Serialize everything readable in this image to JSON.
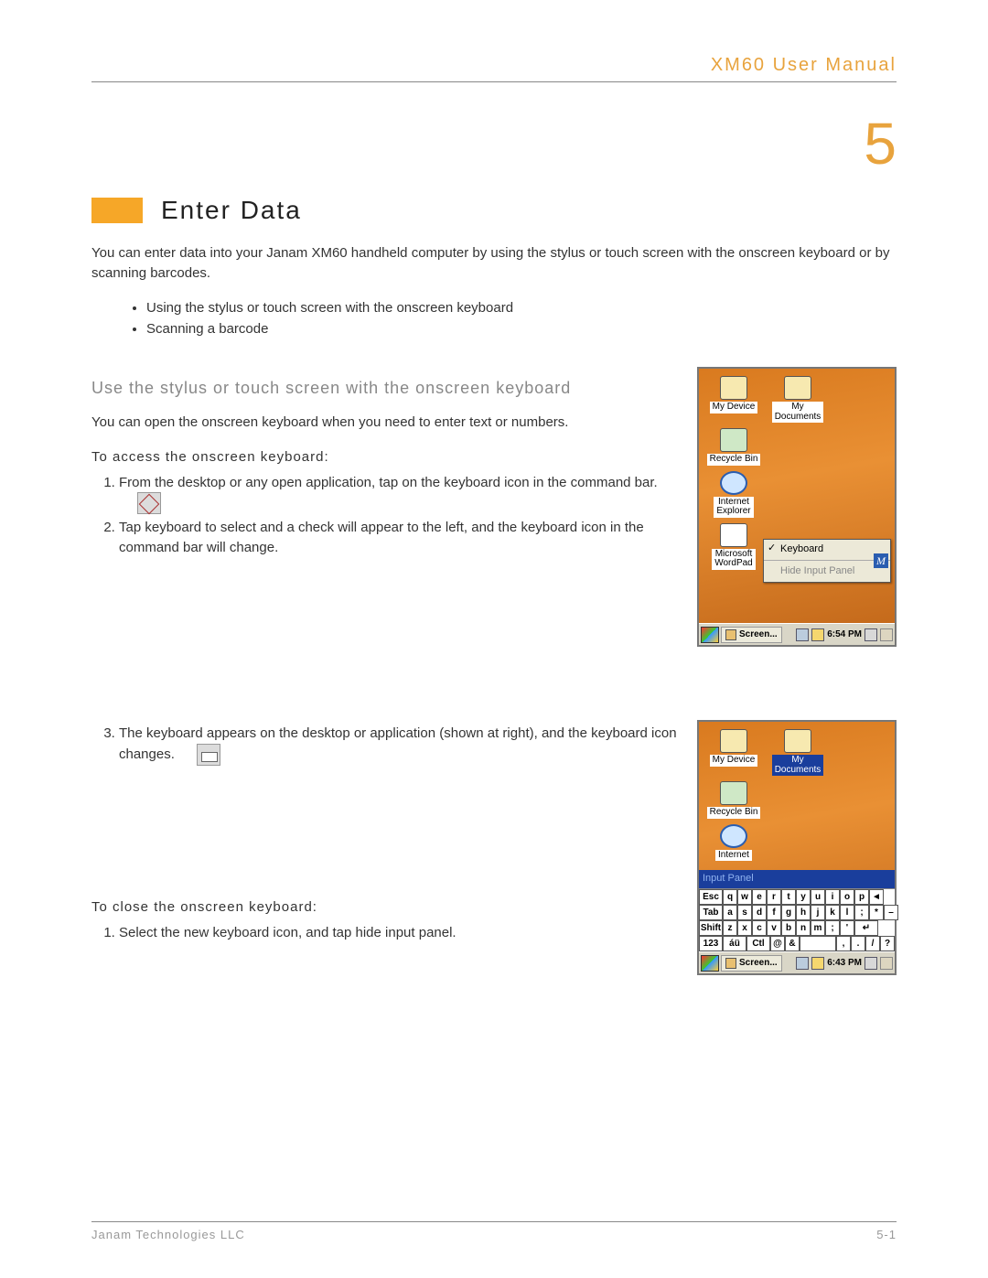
{
  "header": {
    "manual_title": "XM60 User Manual"
  },
  "chapter": "5",
  "section_title": "Enter Data",
  "intro": "You can enter data into your Janam XM60 handheld computer by using the stylus or touch screen with the onscreen keyboard or by scanning barcodes.",
  "bullets": [
    "Using the stylus or touch screen with the onscreen keyboard",
    "Scanning a barcode"
  ],
  "sub_heading": "Use the stylus or touch screen with the onscreen keyboard",
  "sub_para": "You can open the onscreen keyboard when you need to enter text or numbers.",
  "access_hd": "To access the onscreen keyboard:",
  "access_steps": [
    "From the desktop or any open application, tap on the keyboard icon in the command bar.",
    "Tap keyboard to select and a check will appear to the left, and the keyboard icon in the command bar will change."
  ],
  "step3": "The keyboard appears on the desktop or application (shown at right), and the keyboard icon changes.",
  "close_hd": "To close the onscreen keyboard:",
  "close_steps": [
    "Select the new keyboard icon, and tap hide input panel."
  ],
  "shot1": {
    "icons": {
      "my_device": "My Device",
      "my_documents": "My\nDocuments",
      "recycle_bin": "Recycle Bin",
      "internet_explorer": "Internet\nExplorer",
      "wordpad": "Microsoft\nWordPad"
    },
    "menu": {
      "keyboard": "Keyboard",
      "hide": "Hide Input Panel",
      "tag": "M"
    },
    "taskbar": {
      "app": "Screen...",
      "time": "6:54 PM"
    }
  },
  "shot2": {
    "icons": {
      "my_device": "My Device",
      "my_documents": "My\nDocuments",
      "recycle_bin": "Recycle Bin",
      "internet": "Internet"
    },
    "panel_hd": "Input Panel",
    "kb": {
      "r1": [
        "Esc",
        "q",
        "w",
        "e",
        "r",
        "t",
        "y",
        "u",
        "i",
        "o",
        "p",
        "◄"
      ],
      "r2": [
        "Tab",
        "a",
        "s",
        "d",
        "f",
        "g",
        "h",
        "j",
        "k",
        "l",
        ";",
        "*",
        "–"
      ],
      "r3": [
        "Shift",
        "z",
        "x",
        "c",
        "v",
        "b",
        "n",
        "m",
        ";",
        "'",
        "↵"
      ],
      "r4": [
        "123",
        "áü",
        "Ctl",
        "@",
        "&",
        "",
        ",",
        ".",
        "/",
        "?"
      ]
    },
    "taskbar": {
      "app": "Screen...",
      "time": "6:43 PM"
    }
  },
  "footer": {
    "company": "Janam Technologies LLC",
    "page": "5-1"
  }
}
